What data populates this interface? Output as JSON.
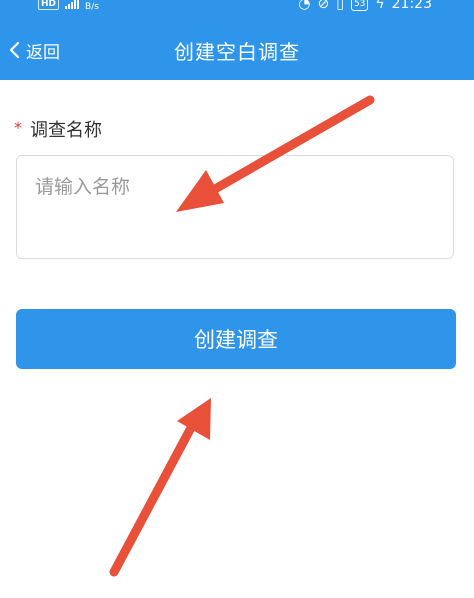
{
  "status_bar": {
    "network_badge": "HD",
    "speed_unit": "B/s",
    "battery": "53",
    "time": "21:23"
  },
  "header": {
    "back_label": "返回",
    "title": "创建空白调查"
  },
  "form": {
    "required_marker": "*",
    "name_label": "调查名称",
    "name_placeholder": "请输入名称",
    "name_value": ""
  },
  "actions": {
    "create_label": "创建调查"
  },
  "colors": {
    "primary": "#2f95ea",
    "required": "#e4393c",
    "annotation_arrow": "#e8503a"
  },
  "icons": [
    "back-chevron-icon",
    "signal-icon",
    "clock-icon",
    "mute-icon",
    "vibrate-icon",
    "battery-icon",
    "annotation-arrow"
  ]
}
